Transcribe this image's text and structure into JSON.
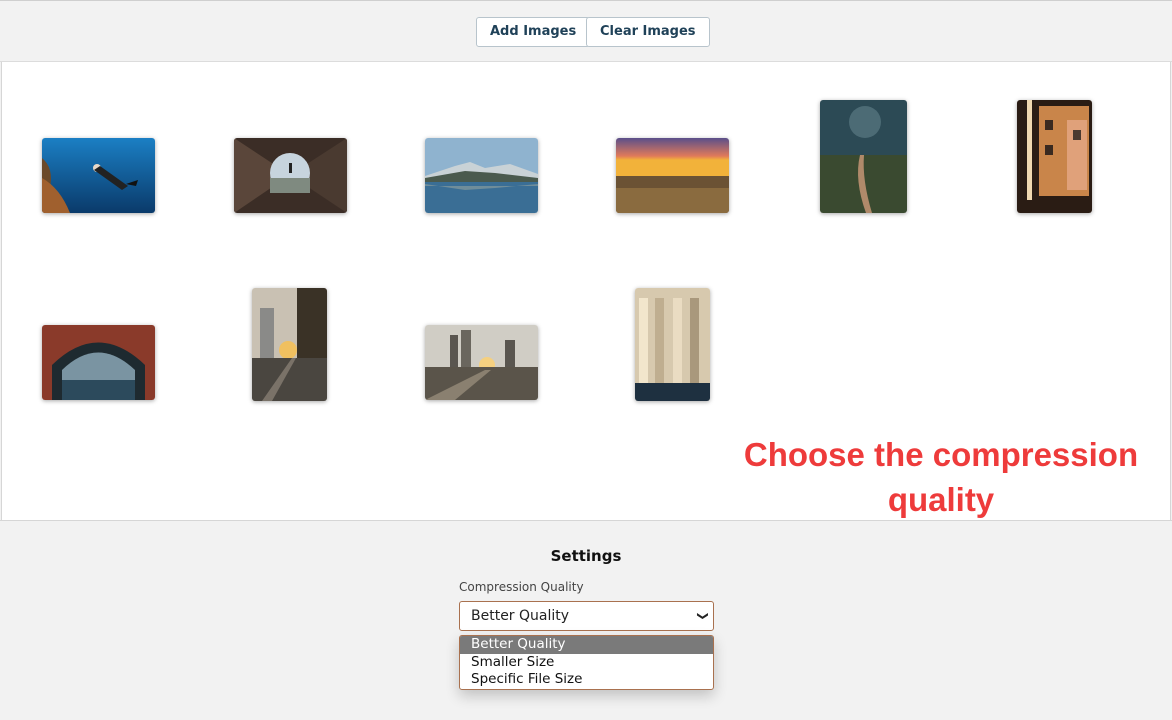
{
  "toolbar": {
    "add_images_label": "Add Images",
    "clear_images_label": "Clear Images"
  },
  "annotation": {
    "text_line1": "Choose the compression",
    "text_line2": "quality",
    "color": "#ee3b3b"
  },
  "settings": {
    "title": "Settings",
    "compression_label": "Compression Quality",
    "selected_value": "Better Quality",
    "options": [
      "Better Quality",
      "Smaller Size",
      "Specific File Size"
    ]
  }
}
